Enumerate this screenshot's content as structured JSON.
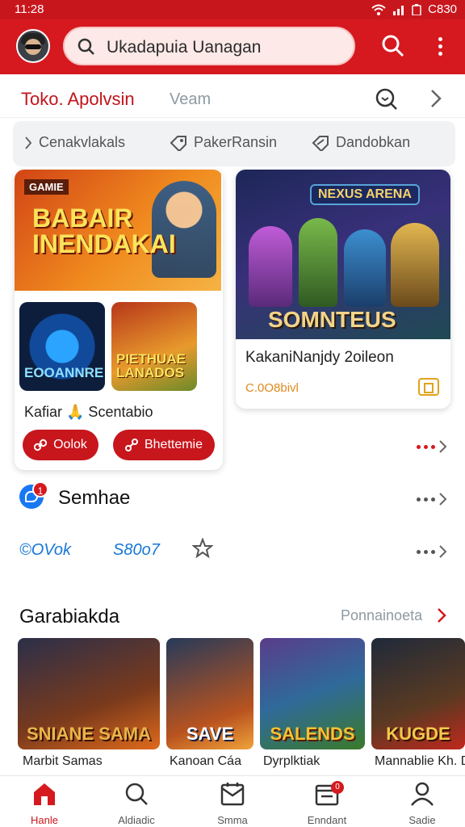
{
  "status": {
    "time": "11:28",
    "battery": "C830"
  },
  "header": {
    "search_text": "Ukadapuia Uanagan"
  },
  "section": {
    "title": "Toko. Apolvsin",
    "subtitle": "Veam"
  },
  "filters": [
    {
      "label": "Cenakvlakals"
    },
    {
      "label": "PakerRansin"
    },
    {
      "label": "Dandobkan"
    }
  ],
  "card1": {
    "brand": "GAMIE",
    "headline": "BABAIR INENDAKAI",
    "thumbs": [
      "EOOANNRE",
      "PIETHUAE LANADOS"
    ],
    "title": "Kafiar 🙏 Scentabio",
    "buttons": [
      "Oolok",
      "Bhettemie"
    ]
  },
  "card2": {
    "logo": "NEXUS ARENA",
    "word": "SOMNTEUS",
    "title": "KakaniNanjdy 2oileon",
    "subtitle": "C.0O8bivl"
  },
  "social": {
    "name": "Semhae",
    "badge": "1"
  },
  "links": [
    "©OVok",
    "S80o7"
  ],
  "games": {
    "title": "Garabiakda",
    "more": "Ponnainoeta",
    "items": [
      {
        "tag": "SNIANE SAMA",
        "label": "Marbit Samas",
        "color": "#e8b54a"
      },
      {
        "tag": "SAVE",
        "label": "Kanoan Cáa",
        "color": "#ffffff"
      },
      {
        "tag": "SALENDS",
        "label": "Dyrplktiak",
        "color": "#f0c435"
      },
      {
        "tag": "KUGDE",
        "label": "Mannablie Kh. D",
        "color": "#f3c94a"
      }
    ]
  },
  "nav": [
    {
      "label": "Hanle",
      "icon": "home-icon"
    },
    {
      "label": "Aldiadic",
      "icon": "search-icon"
    },
    {
      "label": "Smma",
      "icon": "inbox-icon"
    },
    {
      "label": "Enndant",
      "icon": "calendar-icon",
      "badge": "0"
    },
    {
      "label": "Sadie",
      "icon": "profile-icon"
    }
  ],
  "colors": {
    "brand": "#d5191f",
    "link": "#1677d6",
    "muted": "#8f9aa2"
  }
}
